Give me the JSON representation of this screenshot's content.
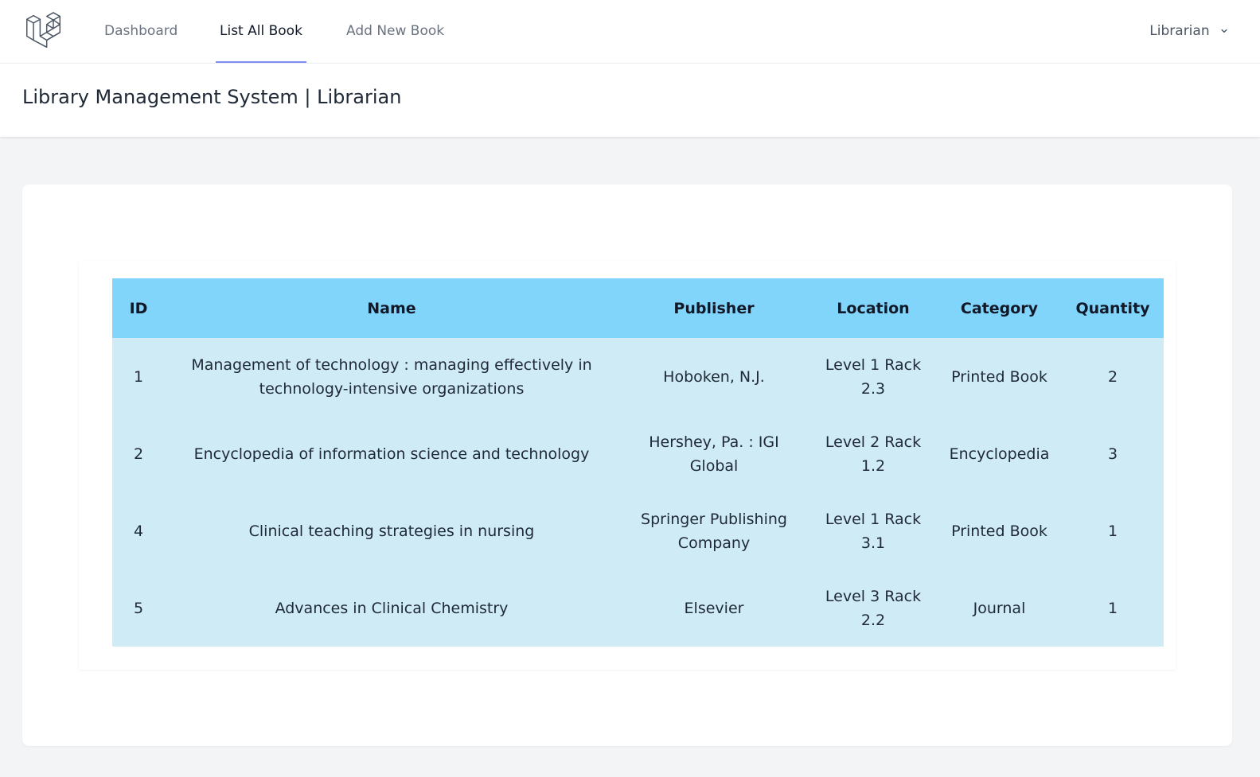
{
  "nav": {
    "links": [
      {
        "label": "Dashboard",
        "active": false
      },
      {
        "label": "List All Book",
        "active": true
      },
      {
        "label": "Add New Book",
        "active": false
      }
    ],
    "user_label": "Librarian",
    "logo_icon": "laravel-logo-icon",
    "accent_color": "#818cf8"
  },
  "header": {
    "title": "Library Management System | Librarian"
  },
  "table": {
    "header_color": "#81d4fa",
    "row_color": "#cfebf5",
    "columns": [
      "ID",
      "Name",
      "Publisher",
      "Location",
      "Category",
      "Quantity"
    ],
    "rows": [
      {
        "id": "1",
        "name": "Management of technology : managing effectively in technology-intensive organizations",
        "publisher": "Hoboken, N.J.",
        "location": "Level 1 Rack 2.3",
        "category": "Printed Book",
        "quantity": "2"
      },
      {
        "id": "2",
        "name": "Encyclopedia of information science and technology",
        "publisher": "Hershey, Pa. : IGI Global",
        "location": "Level 2 Rack 1.2",
        "category": "Encyclopedia",
        "quantity": "3"
      },
      {
        "id": "4",
        "name": "Clinical teaching strategies in nursing",
        "publisher": "Springer Publishing Company",
        "location": "Level 1 Rack 3.1",
        "category": "Printed Book",
        "quantity": "1"
      },
      {
        "id": "5",
        "name": "Advances in Clinical Chemistry",
        "publisher": "Elsevier",
        "location": "Level 3 Rack 2.2",
        "category": "Journal",
        "quantity": "1"
      }
    ]
  }
}
